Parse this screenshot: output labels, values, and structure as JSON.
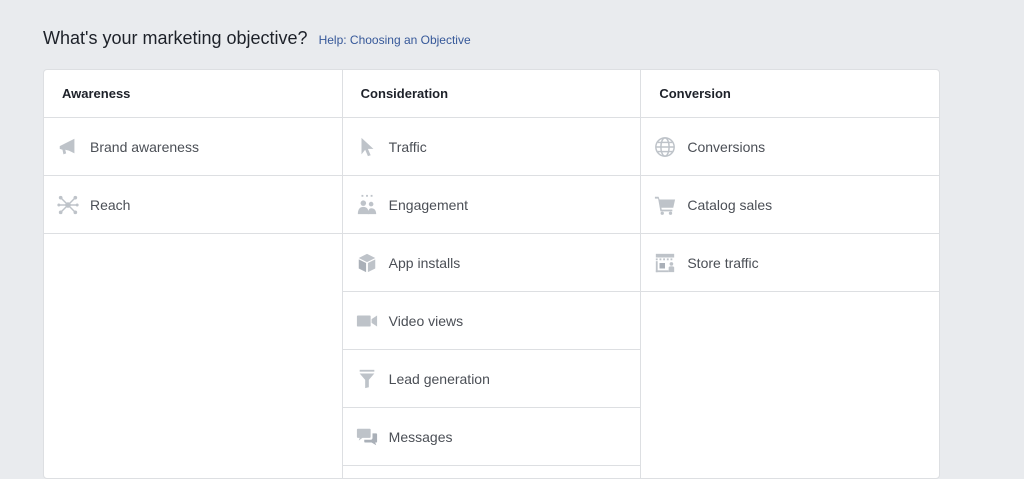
{
  "header": {
    "title": "What's your marketing objective?",
    "help_link": "Help: Choosing an Objective"
  },
  "colors": {
    "icon": "#bec3c9",
    "link": "#365899",
    "border": "#dddfe2",
    "background": "#e9ebee"
  },
  "columns": [
    {
      "title": "Awareness",
      "items": [
        {
          "label": "Brand awareness",
          "icon": "megaphone-icon"
        },
        {
          "label": "Reach",
          "icon": "reach-icon"
        }
      ]
    },
    {
      "title": "Consideration",
      "items": [
        {
          "label": "Traffic",
          "icon": "cursor-icon"
        },
        {
          "label": "Engagement",
          "icon": "people-icon"
        },
        {
          "label": "App installs",
          "icon": "box-icon"
        },
        {
          "label": "Video views",
          "icon": "video-camera-icon"
        },
        {
          "label": "Lead generation",
          "icon": "funnel-icon"
        },
        {
          "label": "Messages",
          "icon": "chat-bubbles-icon"
        }
      ]
    },
    {
      "title": "Conversion",
      "items": [
        {
          "label": "Conversions",
          "icon": "globe-icon"
        },
        {
          "label": "Catalog sales",
          "icon": "shopping-cart-icon"
        },
        {
          "label": "Store traffic",
          "icon": "store-icon"
        }
      ]
    }
  ]
}
